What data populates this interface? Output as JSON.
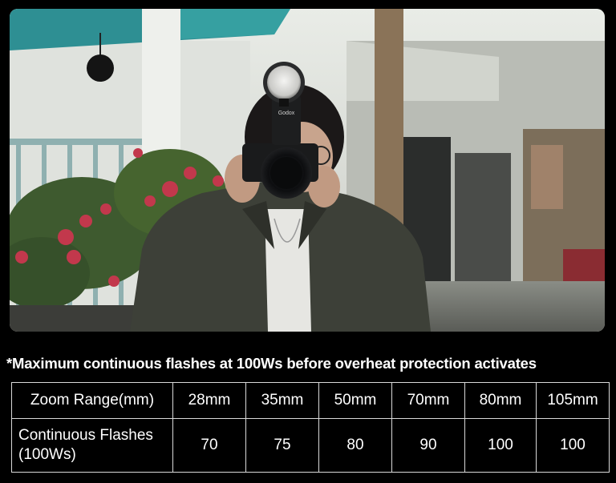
{
  "caption": "*Maximum continuous flashes at 100Ws before overheat protection activates",
  "flash_brand": "Godox",
  "table": {
    "row_headers": [
      "Zoom Range(mm)",
      "Continuous Flashes (100Ws)"
    ],
    "zoom_values": [
      "28mm",
      "35mm",
      "50mm",
      "70mm",
      "80mm",
      "105mm"
    ],
    "flash_values": [
      "70",
      "75",
      "80",
      "90",
      "100",
      "100"
    ]
  }
}
